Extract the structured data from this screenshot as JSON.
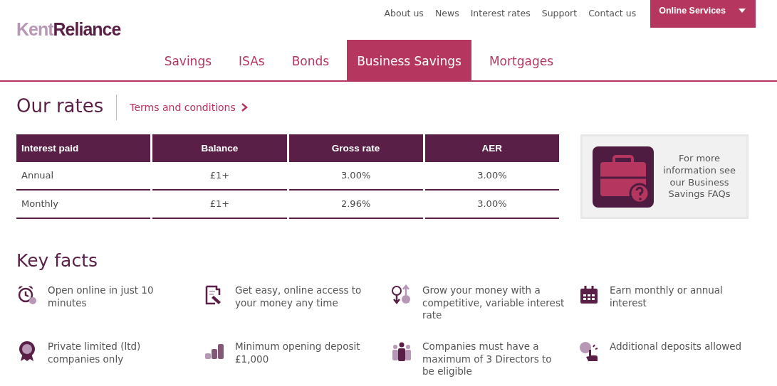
{
  "logo": {
    "light_part": "Kent",
    "dark_part": "Reliance"
  },
  "top_links": [
    "About us",
    "News",
    "Interest rates",
    "Support",
    "Contact us"
  ],
  "online_services": {
    "label": "Online Services"
  },
  "nav_tabs": [
    {
      "label": "Savings",
      "selected": false
    },
    {
      "label": "ISAs",
      "selected": false
    },
    {
      "label": "Bonds",
      "selected": false
    },
    {
      "label": "Business Savings",
      "selected": true
    },
    {
      "label": "Mortgages",
      "selected": false
    }
  ],
  "rates": {
    "title": "Our rates",
    "terms_link": "Terms and conditions",
    "table": {
      "columns": [
        "Interest paid",
        "Balance",
        "Gross rate",
        "AER"
      ],
      "rows": [
        [
          "Annual",
          "£1+",
          "3.00%",
          "3.00%"
        ],
        [
          "Monthly",
          "£1+",
          "2.96%",
          "3.00%"
        ]
      ]
    }
  },
  "faq_card": {
    "text": "For more information see our Business Savings FAQs"
  },
  "key_facts": {
    "title": "Key facts",
    "items": [
      {
        "kind": "alarm",
        "text": "Open online in just 10 minutes"
      },
      {
        "kind": "document",
        "text": "Get easy, online access to your money any time"
      },
      {
        "kind": "percent",
        "text": "Grow your money with a competitive, variable interest rate"
      },
      {
        "kind": "calendar",
        "text": "Earn monthly or annual interest"
      },
      {
        "kind": "rosette",
        "text": "Private limited (ltd) companies only"
      },
      {
        "kind": "coins",
        "text": "Minimum opening deposit £1,000"
      },
      {
        "kind": "people",
        "text": "Companies must have a maximum of 3 Directors to be eligible"
      },
      {
        "kind": "tap",
        "text": "Additional deposits allowed"
      }
    ]
  }
}
